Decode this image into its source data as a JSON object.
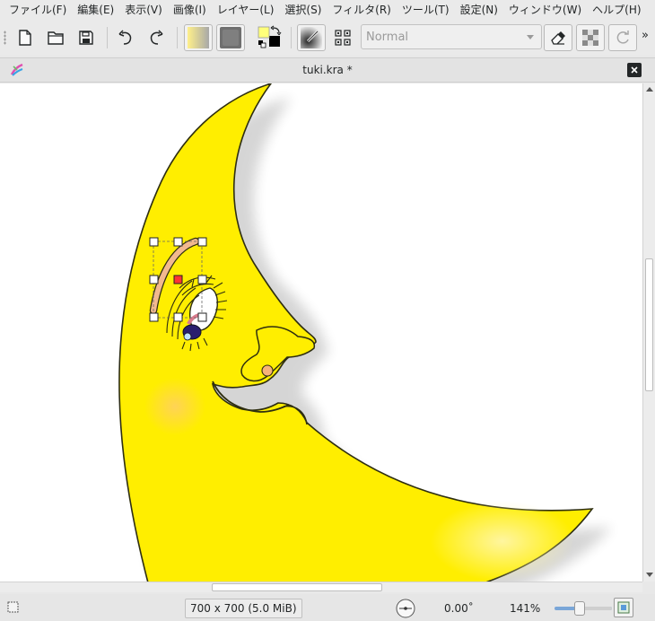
{
  "menubar": {
    "items": [
      "ファイル(F)",
      "編集(E)",
      "表示(V)",
      "画像(I)",
      "レイヤー(L)",
      "選択(S)",
      "フィルタ(R)",
      "ツール(T)",
      "設定(N)",
      "ウィンドウ(W)",
      "ヘルプ(H)"
    ]
  },
  "toolbar": {
    "blend_mode": "Normal",
    "overflow": "»",
    "icons": [
      "new-document-icon",
      "open-folder-icon",
      "save-icon",
      "undo-icon",
      "redo-icon",
      "gradient-swatch-icon",
      "pattern-swatch-icon",
      "color-swap-icon",
      "brush-preset-icon",
      "workspace-chooser-icon",
      "eraser-mode-icon",
      "preserve-alpha-icon",
      "reload-preset-icon"
    ]
  },
  "document": {
    "title": "tuki.kra *"
  },
  "statusbar": {
    "image_size": "700 x 700 (5.0 MiB)",
    "rotation": "0.00˚",
    "zoom": "141%",
    "zoom_fraction": 0.44
  },
  "colors": {
    "foreground": "#ffff7a",
    "background": "#000000",
    "moon_fill": "#ffee00",
    "selection_handle": "#ff3333"
  }
}
